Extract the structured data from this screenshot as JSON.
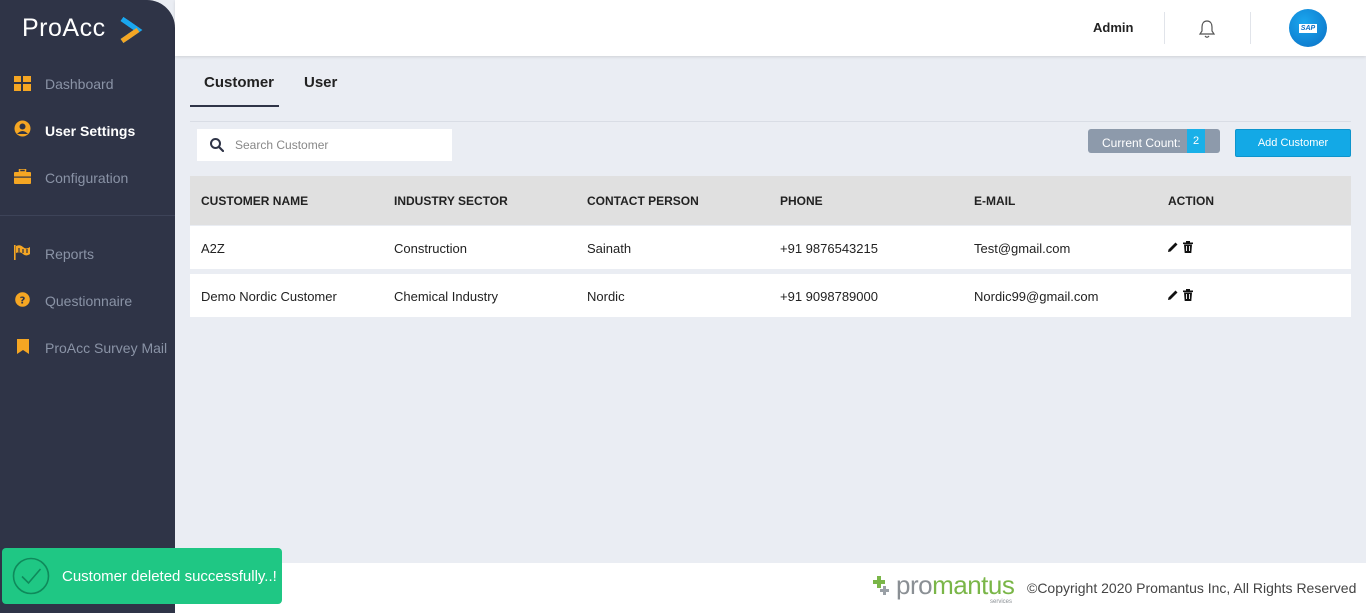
{
  "app": {
    "logo": "ProAcc"
  },
  "sidebar": {
    "items": [
      {
        "label": "Dashboard",
        "icon": "dashboard-icon"
      },
      {
        "label": "User Settings",
        "icon": "user-circle-icon",
        "active": true
      },
      {
        "label": "Configuration",
        "icon": "briefcase-icon"
      },
      {
        "label": "Reports",
        "icon": "flag-icon"
      },
      {
        "label": "Questionnaire",
        "icon": "question-circle-icon"
      },
      {
        "label": "ProAcc Survey Mail",
        "icon": "bookmark-icon"
      }
    ]
  },
  "topbar": {
    "user": "Admin",
    "bell_icon": "bell-icon",
    "avatar": "SAP"
  },
  "tabs": [
    {
      "label": "Customer",
      "active": true
    },
    {
      "label": "User",
      "active": false
    }
  ],
  "search": {
    "placeholder": "Search Customer",
    "value": ""
  },
  "count": {
    "label": "Current Count:",
    "value": "2"
  },
  "add_button": {
    "label": "Add Customer"
  },
  "table": {
    "columns": [
      "CUSTOMER NAME",
      "INDUSTRY SECTOR",
      "CONTACT PERSON",
      "PHONE",
      "E-MAIL",
      "ACTION"
    ],
    "rows": [
      {
        "name": "A2Z",
        "sector": "Construction",
        "contact": "Sainath",
        "phone": "+91 9876543215",
        "email": "Test@gmail.com"
      },
      {
        "name": "Demo Nordic Customer",
        "sector": "Chemical Industry",
        "contact": "Nordic",
        "phone": "+91 9098789000",
        "email": "Nordic99@gmail.com"
      }
    ]
  },
  "footer": {
    "brand": "promantus",
    "brand_sub": "services",
    "copyright": "©Copyright 2020 Promantus Inc, All Rights Reserved"
  },
  "toast": {
    "message": "Customer deleted successfully..!"
  },
  "colors": {
    "sidebar": "#2f3447",
    "accent": "#13a9e6",
    "icon_orange": "#f5a623",
    "toast": "#1fc784"
  }
}
